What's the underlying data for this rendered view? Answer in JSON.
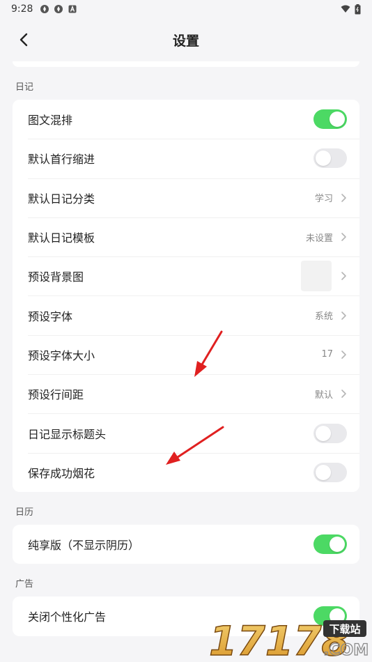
{
  "status_bar": {
    "time": "9:28"
  },
  "header": {
    "title": "设置"
  },
  "sections": [
    {
      "label": "日记",
      "rows": [
        {
          "label": "图文混排",
          "type": "toggle",
          "on": true
        },
        {
          "label": "默认首行缩进",
          "type": "toggle",
          "on": false
        },
        {
          "label": "默认日记分类",
          "type": "value",
          "value": "学习"
        },
        {
          "label": "默认日记模板",
          "type": "value",
          "value": "未设置"
        },
        {
          "label": "预设背景图",
          "type": "image"
        },
        {
          "label": "预设字体",
          "type": "value",
          "value": "系统"
        },
        {
          "label": "预设字体大小",
          "type": "value",
          "value": "17"
        },
        {
          "label": "预设行间距",
          "type": "value",
          "value": "默认"
        },
        {
          "label": "日记显示标题头",
          "type": "toggle",
          "on": false
        },
        {
          "label": "保存成功烟花",
          "type": "toggle",
          "on": false
        }
      ]
    },
    {
      "label": "日历",
      "rows": [
        {
          "label": "纯享版（不显示阴历）",
          "type": "toggle",
          "on": true
        }
      ]
    },
    {
      "label": "广告",
      "rows": [
        {
          "label": "关闭个性化广告",
          "type": "toggle",
          "on": true
        }
      ]
    }
  ],
  "watermark": {
    "number": "17178",
    "tag": "下载站",
    "domain": ".COM"
  },
  "colors": {
    "toggle_on": "#4cd964",
    "toggle_off": "#e9e9ec",
    "annotation_arrow": "#e02020",
    "background": "#f5f5f7"
  },
  "icons": {
    "back": "chevron-left-icon",
    "row_arrow": "chevron-right-icon",
    "wifi": "wifi-icon",
    "battery": "battery-icon"
  }
}
